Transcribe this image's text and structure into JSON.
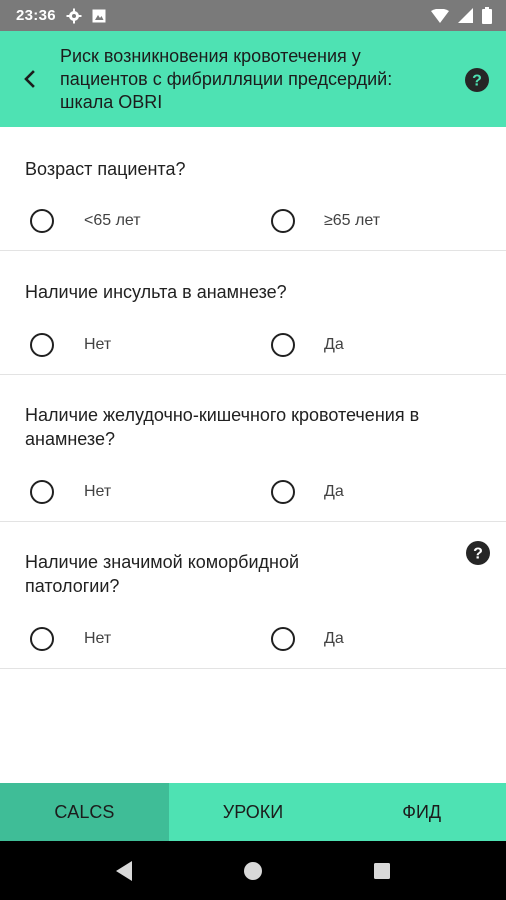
{
  "status_bar": {
    "time": "23:36",
    "icons": [
      "gear-icon",
      "screenshot-icon",
      "wifi-icon",
      "signal-icon",
      "battery-icon"
    ]
  },
  "app_bar": {
    "title": "Риск возникновения кровотечения у пациентов с фибрилляции предсердий: шкала OBRI",
    "icons": [
      "back-arrow-icon",
      "help-icon"
    ],
    "color": "#4ee2b3"
  },
  "questions": [
    {
      "text": "Возраст пациента?",
      "options": [
        "<65 лет",
        "≥65 лет"
      ]
    },
    {
      "text": "Наличие инсульта в анамнезе?",
      "options": [
        "Нет",
        "Да"
      ]
    },
    {
      "text": "Наличие желудочно-кишечного кровотечения в анамнезе?",
      "options": [
        "Нет",
        "Да"
      ]
    },
    {
      "text": "Наличие значимой коморбидной патологии?",
      "options": [
        "Нет",
        "Да"
      ],
      "has_help": true
    }
  ],
  "bottom_nav": {
    "tabs": [
      "CALCS",
      "УРОКИ",
      "ФИД"
    ],
    "active": "CALCS",
    "active_color": "#3fbd97"
  },
  "system_nav": {
    "icons": [
      "back-triangle-icon",
      "home-circle-icon",
      "recents-square-icon"
    ]
  }
}
